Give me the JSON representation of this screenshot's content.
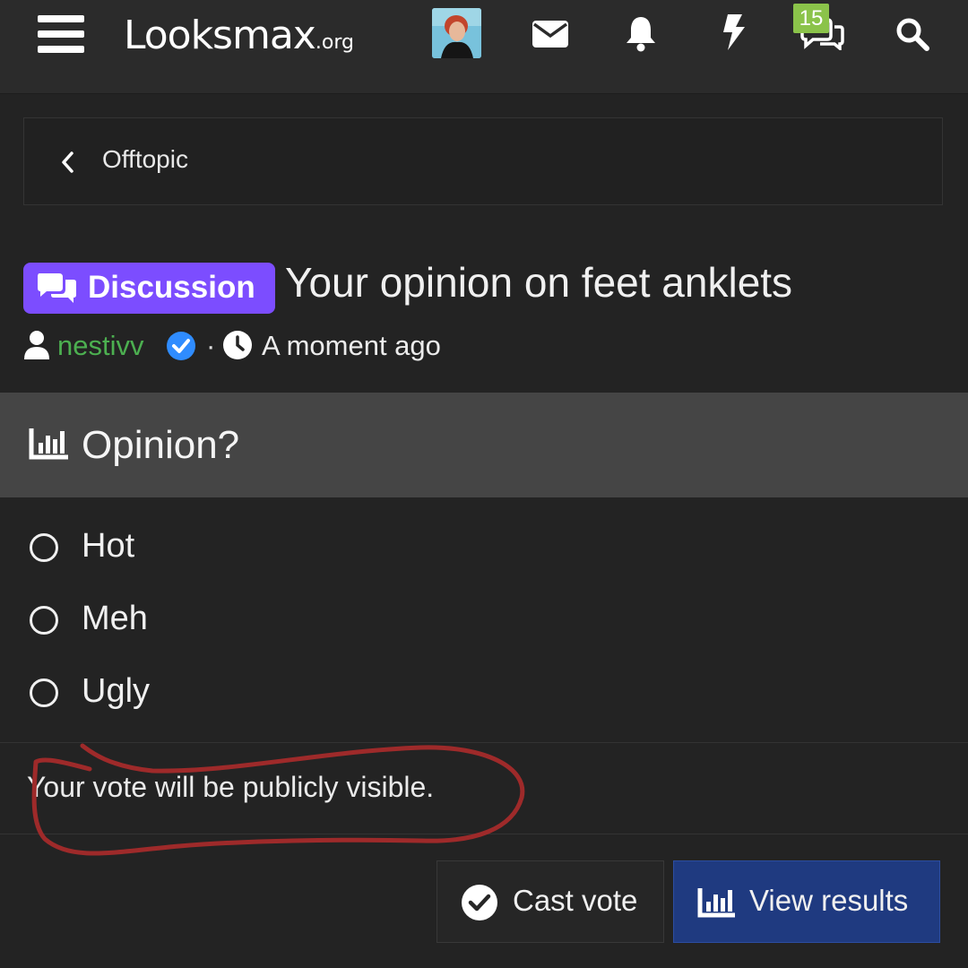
{
  "header": {
    "logo_main": "Looksmax",
    "logo_tld": ".org",
    "icons": [
      "menu-icon",
      "envelope-icon",
      "bell-icon",
      "lightning-icon",
      "chat-icon",
      "search-icon"
    ],
    "conversations_badge": "15"
  },
  "breadcrumb": {
    "label": "Offtopic"
  },
  "thread": {
    "prefix": "Discussion",
    "prefix_color": "#7c4dff",
    "title": "Your opinion on feet anklets",
    "author": "nestivv",
    "author_color": "#4caf50",
    "separator": "·",
    "time": "A moment ago"
  },
  "poll": {
    "question": "Opinion?",
    "options": [
      {
        "label": "Hot"
      },
      {
        "label": "Meh"
      },
      {
        "label": "Ugly"
      }
    ],
    "notice": "Your vote will be publicly visible.",
    "cast_label": "Cast vote",
    "results_label": "View results",
    "results_color": "#1f3a80"
  },
  "annotation": {
    "color": "#9e2a2a"
  }
}
